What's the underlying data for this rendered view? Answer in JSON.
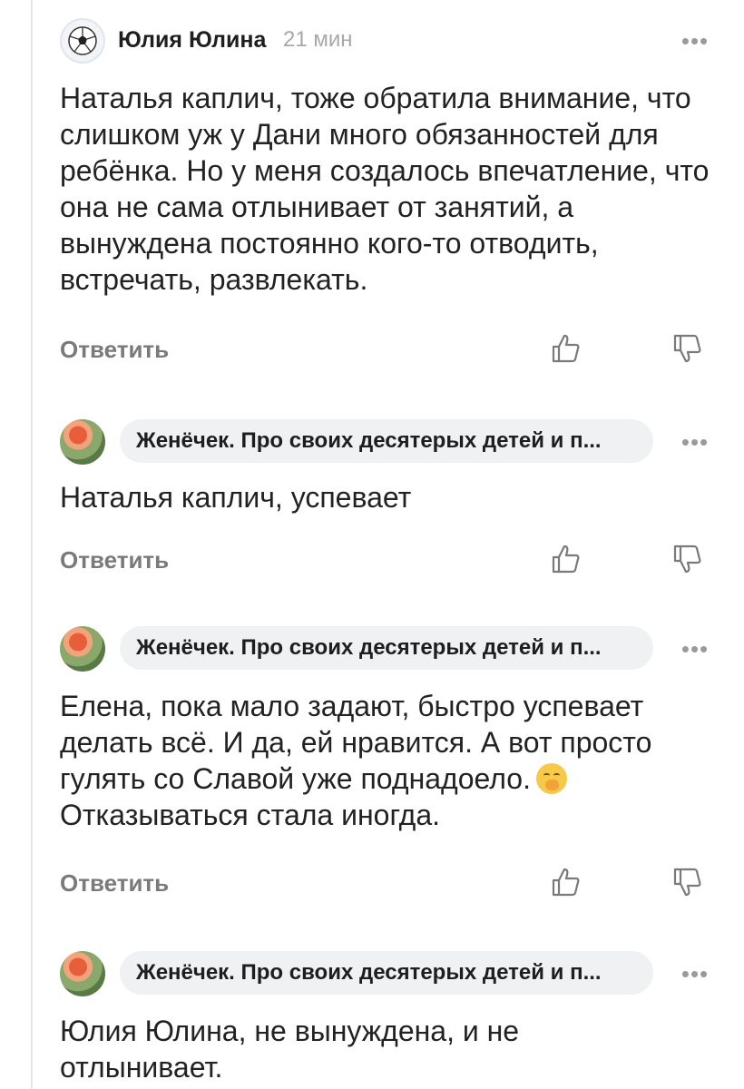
{
  "comments": [
    {
      "author": "Юлия Юлина",
      "time": "21 мин",
      "text": "Наталья каплич, тоже обратила внимание, что слишком уж у Дани много обязанностей для ребёнка. Но у меня создалось впечатление, что она не сама отлынивает от занятий, а вынуждена постоянно кого-то отводить, встречать, развлекать.",
      "reply_label": "Ответить",
      "avatar_icon": "soccer-ball-icon"
    },
    {
      "author": "Женёчек. Про своих десятерых детей и п...",
      "text": "Наталья каплич, успевает",
      "reply_label": "Ответить",
      "avatar_icon": "user-photo"
    },
    {
      "author": "Женёчек. Про своих десятерых детей и п...",
      "text": "Елена, пока мало задают, быстро успевает делать всё. И да, ей нравится. А вот просто гулять со Славой уже поднадоело.",
      "text_after_emoji": "Отказываться стала иногда.",
      "emoji": "face-with-hand-over-mouth-icon",
      "reply_label": "Ответить",
      "avatar_icon": "user-photo"
    },
    {
      "author": "Женёчек. Про своих десятерых детей и п...",
      "text": "Юлия Юлина, не вынуждена, и не отлынивает.",
      "avatar_icon": "user-photo"
    }
  ],
  "icons": {
    "more": "more-dots-icon",
    "like": "thumbs-up-icon",
    "dislike": "thumbs-down-icon"
  },
  "colors": {
    "text": "#222222",
    "muted": "#7a7a7a",
    "time": "#a8a8a8",
    "pill_bg": "#f0f1f3",
    "thread_line": "#e6e6e6"
  }
}
